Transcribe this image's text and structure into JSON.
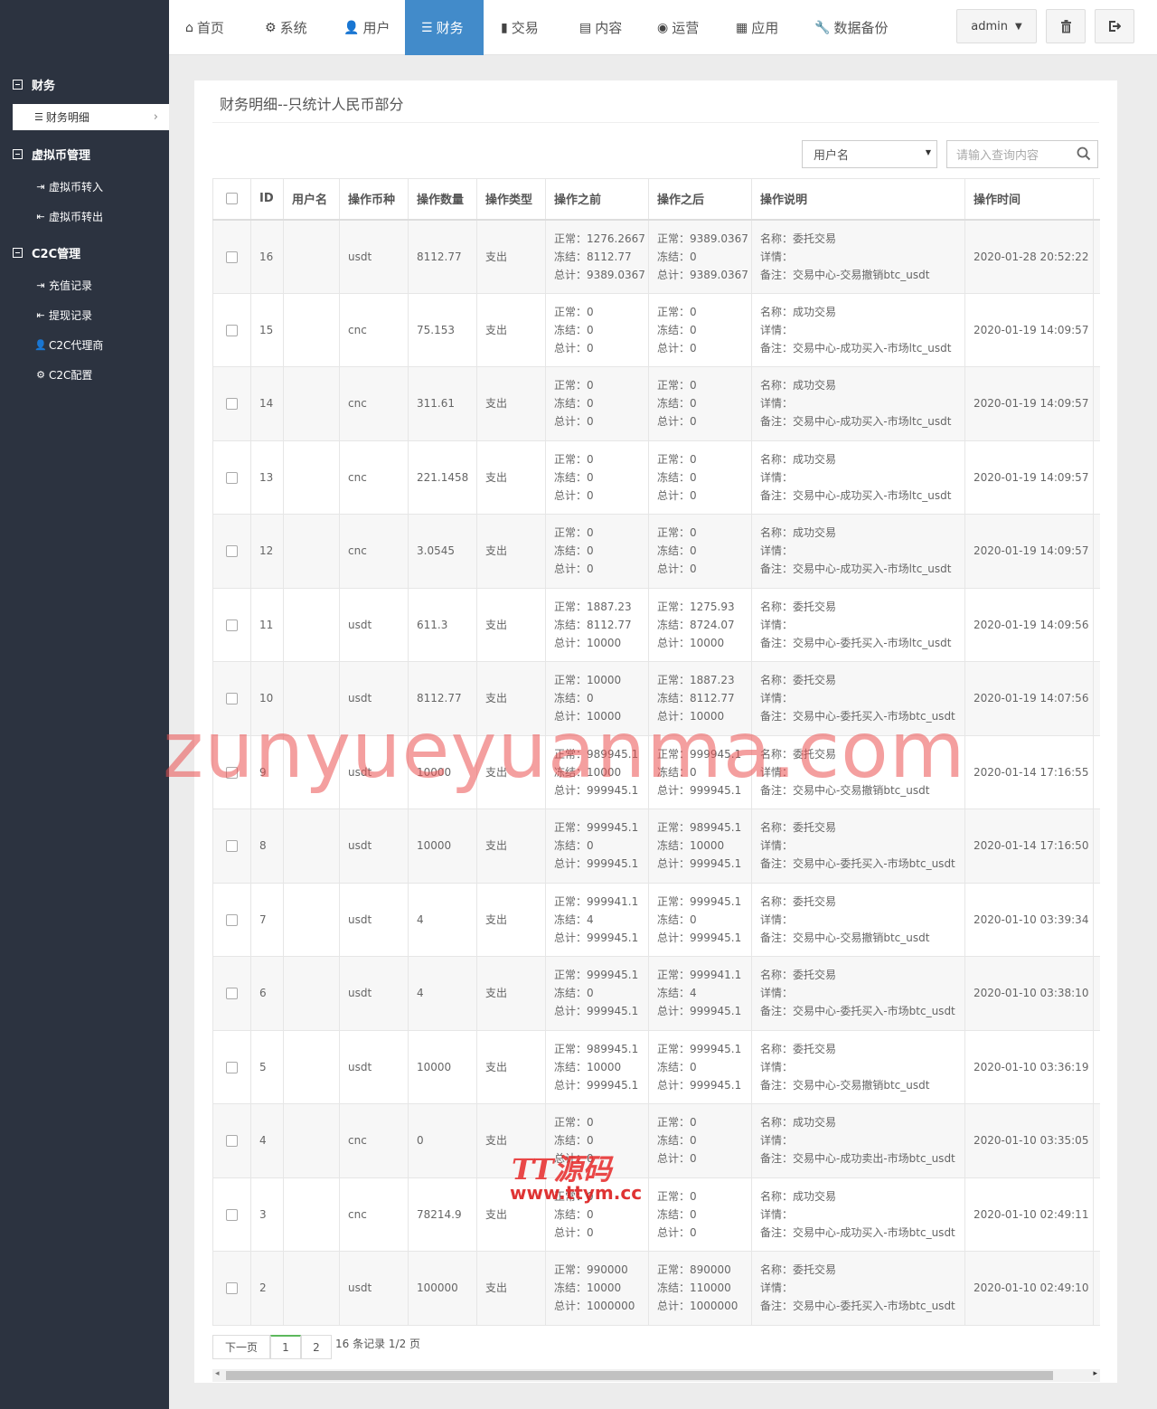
{
  "sidebar": {
    "groups": [
      {
        "label": "财务"
      },
      {
        "label": "虚拟币管理"
      },
      {
        "label": "C2C管理"
      }
    ],
    "active_item": "财务明细",
    "items": [
      {
        "label": "虚拟币转入",
        "icon": "sign-in-icon"
      },
      {
        "label": "虚拟币转出",
        "icon": "sign-out-icon"
      },
      {
        "label": "充值记录",
        "icon": "sign-in-icon"
      },
      {
        "label": "提现记录",
        "icon": "sign-out-icon"
      },
      {
        "label": "C2C代理商",
        "icon": "user-icon"
      },
      {
        "label": "C2C配置",
        "icon": "gear-icon"
      }
    ]
  },
  "topnav": {
    "items": [
      "首页",
      "系统",
      "用户",
      "财务",
      "交易",
      "内容",
      "运营",
      "应用",
      "数据备份"
    ],
    "active": "财务",
    "user": "admin",
    "accent_color": "#428bca"
  },
  "panel": {
    "title": "财务明细--只统计人民币部分",
    "filter_select": "用户名",
    "search_placeholder": "请输入查询内容"
  },
  "table": {
    "columns": [
      "ID",
      "用户名",
      "操作币种",
      "操作数量",
      "操作类型",
      "操作之前",
      "操作之后",
      "操作说明",
      "操作时间"
    ],
    "rows": [
      {
        "id": "16",
        "user": "",
        "coin": "usdt",
        "num": "8112.77",
        "type": "支出",
        "before": [
          "正常：1276.2667",
          "冻结：8112.77",
          "总计：9389.0367"
        ],
        "after": [
          "正常：9389.0367",
          "冻结：0",
          "总计：9389.0367"
        ],
        "desc": [
          "名称：委托交易",
          "详情：",
          "备注：交易中心-交易撤销btc_usdt"
        ],
        "time": "2020-01-28 20:52:22"
      },
      {
        "id": "15",
        "user": "",
        "coin": "cnc",
        "num": "75.153",
        "type": "支出",
        "before": [
          "正常：0",
          "冻结：0",
          "总计：0"
        ],
        "after": [
          "正常：0",
          "冻结：0",
          "总计：0"
        ],
        "desc": [
          "名称：成功交易",
          "详情：",
          "备注：交易中心-成功买入-市场ltc_usdt"
        ],
        "time": "2020-01-19 14:09:57"
      },
      {
        "id": "14",
        "user": "",
        "coin": "cnc",
        "num": "311.61",
        "type": "支出",
        "before": [
          "正常：0",
          "冻结：0",
          "总计：0"
        ],
        "after": [
          "正常：0",
          "冻结：0",
          "总计：0"
        ],
        "desc": [
          "名称：成功交易",
          "详情：",
          "备注：交易中心-成功买入-市场ltc_usdt"
        ],
        "time": "2020-01-19 14:09:57"
      },
      {
        "id": "13",
        "user": "",
        "coin": "cnc",
        "num": "221.1458",
        "type": "支出",
        "before": [
          "正常：0",
          "冻结：0",
          "总计：0"
        ],
        "after": [
          "正常：0",
          "冻结：0",
          "总计：0"
        ],
        "desc": [
          "名称：成功交易",
          "详情：",
          "备注：交易中心-成功买入-市场ltc_usdt"
        ],
        "time": "2020-01-19 14:09:57"
      },
      {
        "id": "12",
        "user": "",
        "coin": "cnc",
        "num": "3.0545",
        "type": "支出",
        "before": [
          "正常：0",
          "冻结：0",
          "总计：0"
        ],
        "after": [
          "正常：0",
          "冻结：0",
          "总计：0"
        ],
        "desc": [
          "名称：成功交易",
          "详情：",
          "备注：交易中心-成功买入-市场ltc_usdt"
        ],
        "time": "2020-01-19 14:09:57"
      },
      {
        "id": "11",
        "user": "",
        "coin": "usdt",
        "num": "611.3",
        "type": "支出",
        "before": [
          "正常：1887.23",
          "冻结：8112.77",
          "总计：10000"
        ],
        "after": [
          "正常：1275.93",
          "冻结：8724.07",
          "总计：10000"
        ],
        "desc": [
          "名称：委托交易",
          "详情：",
          "备注：交易中心-委托买入-市场ltc_usdt"
        ],
        "time": "2020-01-19 14:09:56"
      },
      {
        "id": "10",
        "user": "",
        "coin": "usdt",
        "num": "8112.77",
        "type": "支出",
        "before": [
          "正常：10000",
          "冻结：0",
          "总计：10000"
        ],
        "after": [
          "正常：1887.23",
          "冻结：8112.77",
          "总计：10000"
        ],
        "desc": [
          "名称：委托交易",
          "详情：",
          "备注：交易中心-委托买入-市场btc_usdt"
        ],
        "time": "2020-01-19 14:07:56"
      },
      {
        "id": "9",
        "user": "",
        "coin": "usdt",
        "num": "10000",
        "type": "支出",
        "before": [
          "正常：989945.1",
          "冻结：10000",
          "总计：999945.1"
        ],
        "after": [
          "正常：999945.1",
          "冻结：0",
          "总计：999945.1"
        ],
        "desc": [
          "名称：委托交易",
          "详情：",
          "备注：交易中心-交易撤销btc_usdt"
        ],
        "time": "2020-01-14 17:16:55"
      },
      {
        "id": "8",
        "user": "",
        "coin": "usdt",
        "num": "10000",
        "type": "支出",
        "before": [
          "正常：999945.1",
          "冻结：0",
          "总计：999945.1"
        ],
        "after": [
          "正常：989945.1",
          "冻结：10000",
          "总计：999945.1"
        ],
        "desc": [
          "名称：委托交易",
          "详情：",
          "备注：交易中心-委托买入-市场btc_usdt"
        ],
        "time": "2020-01-14 17:16:50"
      },
      {
        "id": "7",
        "user": "",
        "coin": "usdt",
        "num": "4",
        "type": "支出",
        "before": [
          "正常：999941.1",
          "冻结：4",
          "总计：999945.1"
        ],
        "after": [
          "正常：999945.1",
          "冻结：0",
          "总计：999945.1"
        ],
        "desc": [
          "名称：委托交易",
          "详情：",
          "备注：交易中心-交易撤销btc_usdt"
        ],
        "time": "2020-01-10 03:39:34"
      },
      {
        "id": "6",
        "user": "",
        "coin": "usdt",
        "num": "4",
        "type": "支出",
        "before": [
          "正常：999945.1",
          "冻结：0",
          "总计：999945.1"
        ],
        "after": [
          "正常：999941.1",
          "冻结：4",
          "总计：999945.1"
        ],
        "desc": [
          "名称：委托交易",
          "详情：",
          "备注：交易中心-委托买入-市场btc_usdt"
        ],
        "time": "2020-01-10 03:38:10"
      },
      {
        "id": "5",
        "user": "",
        "coin": "usdt",
        "num": "10000",
        "type": "支出",
        "before": [
          "正常：989945.1",
          "冻结：10000",
          "总计：999945.1"
        ],
        "after": [
          "正常：999945.1",
          "冻结：0",
          "总计：999945.1"
        ],
        "desc": [
          "名称：委托交易",
          "详情：",
          "备注：交易中心-交易撤销btc_usdt"
        ],
        "time": "2020-01-10 03:36:19"
      },
      {
        "id": "4",
        "user": "",
        "coin": "cnc",
        "num": "0",
        "type": "支出",
        "before": [
          "正常：0",
          "冻结：0",
          "总计：0"
        ],
        "after": [
          "正常：0",
          "冻结：0",
          "总计：0"
        ],
        "desc": [
          "名称：成功交易",
          "详情：",
          "备注：交易中心-成功卖出-市场btc_usdt"
        ],
        "time": "2020-01-10 03:35:05"
      },
      {
        "id": "3",
        "user": "",
        "coin": "cnc",
        "num": "78214.9",
        "type": "支出",
        "before": [
          "正常：0",
          "冻结：0",
          "总计：0"
        ],
        "after": [
          "正常：0",
          "冻结：0",
          "总计：0"
        ],
        "desc": [
          "名称：成功交易",
          "详情：",
          "备注：交易中心-成功买入-市场btc_usdt"
        ],
        "time": "2020-01-10 02:49:11"
      },
      {
        "id": "2",
        "user": "",
        "coin": "usdt",
        "num": "100000",
        "type": "支出",
        "before": [
          "正常：990000",
          "冻结：10000",
          "总计：1000000"
        ],
        "after": [
          "正常：890000",
          "冻结：110000",
          "总计：1000000"
        ],
        "desc": [
          "名称：委托交易",
          "详情：",
          "备注：交易中心-委托买入-市场btc_usdt"
        ],
        "time": "2020-01-10 02:49:10"
      }
    ]
  },
  "pager": {
    "next": "下一页",
    "pages": [
      "1",
      "2"
    ],
    "current": "1",
    "info": "16 条记录 1/2 页"
  },
  "watermarks": {
    "big": "zunyueyuanma.com",
    "logo": "TT源码",
    "logo_url": "www.ttym.cc"
  }
}
